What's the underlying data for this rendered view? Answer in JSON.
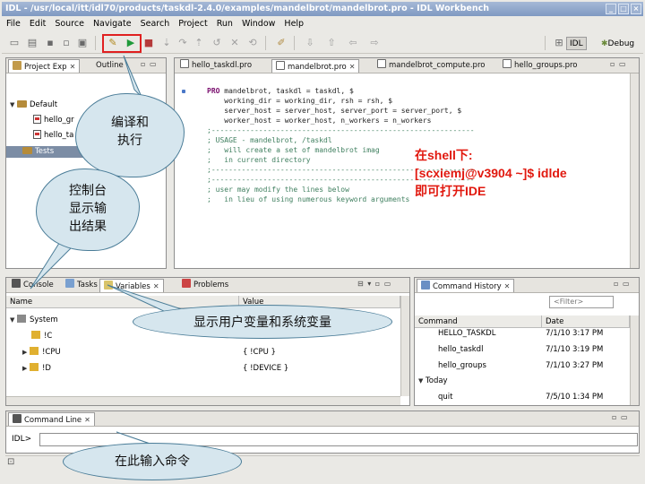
{
  "window": {
    "title": "IDL - /usr/local/itt/idl70/products/taskdl-2.4.0/examples/mandelbrot/mandelbrot.pro - IDL Workbench",
    "controls": [
      "_",
      "□",
      "×"
    ]
  },
  "menu": [
    "File",
    "Edit",
    "Source",
    "Navigate",
    "Search",
    "Project",
    "Run",
    "Window",
    "Help"
  ],
  "perspectives": [
    {
      "label": "IDL",
      "active": true
    },
    {
      "label": "Debug",
      "active": false
    }
  ],
  "project_explorer": {
    "tabs": [
      "Project Exp",
      "Outline"
    ],
    "items": [
      {
        "label": "Default",
        "type": "folder",
        "level": 0,
        "expanded": true
      },
      {
        "label": "hello_gr",
        "type": "file",
        "level": 1
      },
      {
        "label": "hello_ta",
        "type": "file",
        "level": 1
      },
      {
        "label": "Tests",
        "type": "folder",
        "level": 0,
        "selected": true
      }
    ]
  },
  "editor": {
    "tabs": [
      {
        "label": "hello_taskdl.pro",
        "active": false
      },
      {
        "label": "mandelbrot.pro",
        "active": true
      },
      {
        "label": "mandelbrot_compute.pro",
        "active": false
      },
      {
        "label": "hello_groups.pro",
        "active": false
      }
    ],
    "lines": [
      "PRO mandelbrot, taskdl = taskdl, $",
      "    working_dir = working_dir, rsh = rsh, $",
      "    server_host = server_host, server_port = server_port, $",
      "    worker_host = worker_host, n_workers = n_workers",
      "",
      ";-------------------------------------------------------------",
      "; USAGE - mandelbrot, /taskdl",
      ";   will create a set of mandelbrot imag",
      ";   in current directory",
      ";-------------------------------------------------------------",
      "",
      ";-------------------------------------------------------------",
      "; user may modify the lines below",
      ";   in lieu of using numerous keyword arguments"
    ]
  },
  "bottom_tabs": [
    "Console",
    "Tasks",
    "Variables",
    "Problems"
  ],
  "variables": {
    "columns": [
      "Name",
      "Value"
    ],
    "rows": [
      {
        "name": "System",
        "value": "",
        "level": 0,
        "expanded": true
      },
      {
        "name": "!C",
        "value": "",
        "level": 1
      },
      {
        "name": "!CPU",
        "value": "{ !CPU }",
        "level": 1
      },
      {
        "name": "!D",
        "value": "{ !DEVICE }",
        "level": 1
      }
    ]
  },
  "command_history": {
    "title": "Command History",
    "filter_placeholder": "<Filter>",
    "columns": [
      "Command",
      "Date"
    ],
    "rows": [
      {
        "command": "HELLO_TASKDL",
        "date": "7/1/10 3:17 PM",
        "level": 1
      },
      {
        "command": "hello_taskdl",
        "date": "7/1/10 3:19 PM",
        "level": 1
      },
      {
        "command": "hello_groups",
        "date": "7/1/10 3:27 PM",
        "level": 1
      },
      {
        "command": "Today",
        "date": "",
        "level": 0
      },
      {
        "command": "quit",
        "date": "7/5/10 1:34 PM",
        "level": 1
      }
    ]
  },
  "command_line": {
    "title": "Command Line",
    "prompt": "IDL>",
    "value": ""
  },
  "annotations": {
    "compile_run": "编译和\n执行",
    "console_output": "控制台\n显示输\n出结果",
    "variables_note": "显示用户变量和系统变量",
    "input_command": "在此输入命令",
    "launch_note": [
      "在shell下:",
      "[scxiemj@v3904 ~]$ idlde",
      "即可打开IDE"
    ]
  },
  "colors": {
    "annotation_red": "#e1190f",
    "callout_fill": "#d6e6ee",
    "title_bar": "#8fa6cb",
    "selection": "#7c8da5"
  }
}
